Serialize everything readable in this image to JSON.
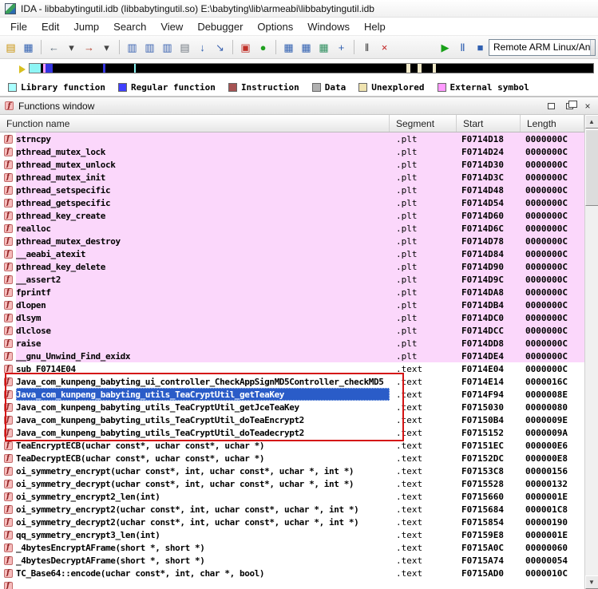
{
  "window": {
    "title": "IDA - libbabytingutil.idb (libbabytingutil.so) E:\\babyting\\lib\\armeabi\\libbabytingutil.idb"
  },
  "menu": {
    "items": [
      "File",
      "Edit",
      "Jump",
      "Search",
      "View",
      "Debugger",
      "Options",
      "Windows",
      "Help"
    ]
  },
  "toolbar": {
    "icons": [
      {
        "name": "open-file-icon",
        "glyph": "▤",
        "color": "#c8920a"
      },
      {
        "name": "save-file-icon",
        "glyph": "▦",
        "color": "#2f5fb0"
      },
      {
        "name": "separator"
      },
      {
        "name": "navigate-back-icon",
        "glyph": "←",
        "color": "#5a6b7a"
      },
      {
        "name": "back-history-dropdown-icon",
        "glyph": "▾",
        "color": "#444444"
      },
      {
        "name": "navigate-forward-icon",
        "glyph": "→",
        "color": "#b43c28"
      },
      {
        "name": "forward-history-dropdown-icon",
        "glyph": "▾",
        "color": "#444444"
      },
      {
        "name": "separator"
      },
      {
        "name": "jump-immediate-icon",
        "glyph": "▥",
        "color": "#3a62b0"
      },
      {
        "name": "search-text-icon",
        "glyph": "▥",
        "color": "#3a62b0"
      },
      {
        "name": "search-sequence-icon",
        "glyph": "▥",
        "color": "#3a62b0"
      },
      {
        "name": "print-icon",
        "glyph": "▤",
        "color": "#707880"
      },
      {
        "name": "jump-down-icon",
        "glyph": "↓",
        "color": "#2f5fb0"
      },
      {
        "name": "cross-references-icon",
        "glyph": "↘",
        "color": "#3a62b0"
      },
      {
        "name": "separator"
      },
      {
        "name": "ida-view-icon",
        "glyph": "▣",
        "color": "#c03028"
      },
      {
        "name": "hex-view-icon",
        "glyph": "●",
        "color": "#1fa01f"
      },
      {
        "name": "separator"
      },
      {
        "name": "open-structures-icon",
        "glyph": "▦",
        "color": "#2f5fb0"
      },
      {
        "name": "open-enums-icon",
        "glyph": "▦",
        "color": "#2f5fb0"
      },
      {
        "name": "open-segments-icon",
        "glyph": "▦",
        "color": "#2f8f5f"
      },
      {
        "name": "add-window-icon",
        "glyph": "+",
        "color": "#2f5fb0"
      },
      {
        "name": "separator"
      },
      {
        "name": "navigator-bars-icon",
        "glyph": "‖",
        "color": "#333333"
      },
      {
        "name": "close-view-icon",
        "glyph": "×",
        "color": "#c02020"
      },
      {
        "name": "spacer"
      },
      {
        "name": "start-process-icon",
        "glyph": "▶",
        "color": "#18a018"
      },
      {
        "name": "pause-process-icon",
        "glyph": "Ⅱ",
        "color": "#2f5fb0"
      },
      {
        "name": "stop-process-icon",
        "glyph": "■",
        "color": "#2f5fb0"
      }
    ],
    "debugger_label": "Remote ARM Linux/An",
    "dropdown_arrow": "▾"
  },
  "navband": {
    "segments": [
      {
        "color": "#8ef5f5",
        "width_pct": 2.0
      },
      {
        "color": "#000000",
        "width_pct": 0.4
      },
      {
        "color": "#ff9aff",
        "width_pct": 0.5
      },
      {
        "color": "#3535e0",
        "width_pct": 1.2
      },
      {
        "color": "#000000",
        "width_pct": 9.0
      },
      {
        "color": "#3535e0",
        "width_pct": 0.4
      },
      {
        "color": "#000000",
        "width_pct": 5.0
      },
      {
        "color": "#8ef5f5",
        "width_pct": 0.3
      },
      {
        "color": "#000000",
        "width_pct": 48.0
      },
      {
        "color": "#efe8c8",
        "width_pct": 0.8
      },
      {
        "color": "#000000",
        "width_pct": 1.2
      },
      {
        "color": "#efe8c8",
        "width_pct": 0.8
      },
      {
        "color": "#000000",
        "width_pct": 2.0
      },
      {
        "color": "#efe8c8",
        "width_pct": 0.5
      },
      {
        "color": "#000000",
        "width_pct": 27.9
      }
    ]
  },
  "legend": {
    "items": [
      {
        "label": "Library function",
        "color": "#aaffff"
      },
      {
        "label": "Regular function",
        "color": "#4040ff"
      },
      {
        "label": "Instruction",
        "color": "#a65353"
      },
      {
        "label": "Data",
        "color": "#b0b0b0"
      },
      {
        "label": "Unexplored",
        "color": "#efe3b0"
      },
      {
        "label": "External symbol",
        "color": "#ff9aff"
      }
    ]
  },
  "functions_window": {
    "title": "Functions window",
    "close_glyph": "×",
    "columns": [
      "Function name",
      "Segment",
      "Start",
      "Length"
    ],
    "highlight_box": {
      "start_row_index": 19,
      "end_row_index": 23,
      "color": "#d41414"
    },
    "scrollbar": {
      "up": "▲",
      "down": "▼"
    },
    "rows": [
      {
        "name": "strncpy",
        "segment": ".plt",
        "start": "F0714D18",
        "length": "0000000C",
        "kind": "plt"
      },
      {
        "name": "pthread_mutex_lock",
        "segment": ".plt",
        "start": "F0714D24",
        "length": "0000000C",
        "kind": "plt"
      },
      {
        "name": "pthread_mutex_unlock",
        "segment": ".plt",
        "start": "F0714D30",
        "length": "0000000C",
        "kind": "plt"
      },
      {
        "name": "pthread_mutex_init",
        "segment": ".plt",
        "start": "F0714D3C",
        "length": "0000000C",
        "kind": "plt"
      },
      {
        "name": "pthread_setspecific",
        "segment": ".plt",
        "start": "F0714D48",
        "length": "0000000C",
        "kind": "plt"
      },
      {
        "name": "pthread_getspecific",
        "segment": ".plt",
        "start": "F0714D54",
        "length": "0000000C",
        "kind": "plt"
      },
      {
        "name": "pthread_key_create",
        "segment": ".plt",
        "start": "F0714D60",
        "length": "0000000C",
        "kind": "plt"
      },
      {
        "name": "realloc",
        "segment": ".plt",
        "start": "F0714D6C",
        "length": "0000000C",
        "kind": "plt"
      },
      {
        "name": "pthread_mutex_destroy",
        "segment": ".plt",
        "start": "F0714D78",
        "length": "0000000C",
        "kind": "plt"
      },
      {
        "name": "__aeabi_atexit",
        "segment": ".plt",
        "start": "F0714D84",
        "length": "0000000C",
        "kind": "plt"
      },
      {
        "name": "pthread_key_delete",
        "segment": ".plt",
        "start": "F0714D90",
        "length": "0000000C",
        "kind": "plt"
      },
      {
        "name": "__assert2",
        "segment": ".plt",
        "start": "F0714D9C",
        "length": "0000000C",
        "kind": "plt"
      },
      {
        "name": "fprintf",
        "segment": ".plt",
        "start": "F0714DA8",
        "length": "0000000C",
        "kind": "plt"
      },
      {
        "name": "dlopen",
        "segment": ".plt",
        "start": "F0714DB4",
        "length": "0000000C",
        "kind": "plt"
      },
      {
        "name": "dlsym",
        "segment": ".plt",
        "start": "F0714DC0",
        "length": "0000000C",
        "kind": "plt"
      },
      {
        "name": "dlclose",
        "segment": ".plt",
        "start": "F0714DCC",
        "length": "0000000C",
        "kind": "plt"
      },
      {
        "name": "raise",
        "segment": ".plt",
        "start": "F0714DD8",
        "length": "0000000C",
        "kind": "plt"
      },
      {
        "name": "__gnu_Unwind_Find_exidx",
        "segment": ".plt",
        "start": "F0714DE4",
        "length": "0000000C",
        "kind": "plt"
      },
      {
        "name": "sub_F0714E04",
        "segment": ".text",
        "start": "F0714E04",
        "length": "0000000C",
        "kind": "text"
      },
      {
        "name": "Java_com_kunpeng_babyting_ui_controller_CheckAppSignMD5Controller_checkMD5",
        "segment": ".text",
        "start": "F0714E14",
        "length": "0000016C",
        "kind": "text"
      },
      {
        "name": "Java_com_kunpeng_babyting_utils_TeaCryptUtil_getTeaKey",
        "segment": ".text",
        "start": "F0714F94",
        "length": "0000008E",
        "kind": "text",
        "selected": true
      },
      {
        "name": "Java_com_kunpeng_babyting_utils_TeaCryptUtil_getJceTeaKey",
        "segment": ".text",
        "start": "F0715030",
        "length": "00000080",
        "kind": "text"
      },
      {
        "name": "Java_com_kunpeng_babyting_utils_TeaCryptUtil_doTeaEncrypt2",
        "segment": ".text",
        "start": "F07150B4",
        "length": "0000009E",
        "kind": "text"
      },
      {
        "name": "Java_com_kunpeng_babyting_utils_TeaCryptUtil_doTeadecrypt2",
        "segment": ".text",
        "start": "F0715152",
        "length": "0000009A",
        "kind": "text"
      },
      {
        "name": "TeaEncryptECB(uchar const*, uchar const*, uchar *)",
        "segment": ".text",
        "start": "F07151EC",
        "length": "000000E6",
        "kind": "text"
      },
      {
        "name": "TeaDecryptECB(uchar const*, uchar const*, uchar *)",
        "segment": ".text",
        "start": "F07152DC",
        "length": "000000E8",
        "kind": "text"
      },
      {
        "name": "oi_symmetry_encrypt(uchar const*, int, uchar const*, uchar *, int *)",
        "segment": ".text",
        "start": "F07153C8",
        "length": "00000156",
        "kind": "text"
      },
      {
        "name": "oi_symmetry_decrypt(uchar const*, int, uchar const*, uchar *, int *)",
        "segment": ".text",
        "start": "F0715528",
        "length": "00000132",
        "kind": "text"
      },
      {
        "name": "oi_symmetry_encrypt2_len(int)",
        "segment": ".text",
        "start": "F0715660",
        "length": "0000001E",
        "kind": "text"
      },
      {
        "name": "oi_symmetry_encrypt2(uchar const*, int, uchar const*, uchar *, int *)",
        "segment": ".text",
        "start": "F0715684",
        "length": "000001C8",
        "kind": "text"
      },
      {
        "name": "oi_symmetry_decrypt2(uchar const*, int, uchar const*, uchar *, int *)",
        "segment": ".text",
        "start": "F0715854",
        "length": "00000190",
        "kind": "text"
      },
      {
        "name": "qq_symmetry_encrypt3_len(int)",
        "segment": ".text",
        "start": "F07159E8",
        "length": "0000001E",
        "kind": "text"
      },
      {
        "name": "_4bytesEncryptAFrame(short *, short *)",
        "segment": ".text",
        "start": "F0715A0C",
        "length": "00000060",
        "kind": "text"
      },
      {
        "name": "_4bytesDecryptAFrame(short *, short *)",
        "segment": ".text",
        "start": "F0715A74",
        "length": "00000054",
        "kind": "text"
      },
      {
        "name": "TC_Base64::encode(uchar const*, int, char *, bool)",
        "segment": ".text",
        "start": "F0715AD0",
        "length": "0000010C",
        "kind": "text"
      }
    ]
  }
}
